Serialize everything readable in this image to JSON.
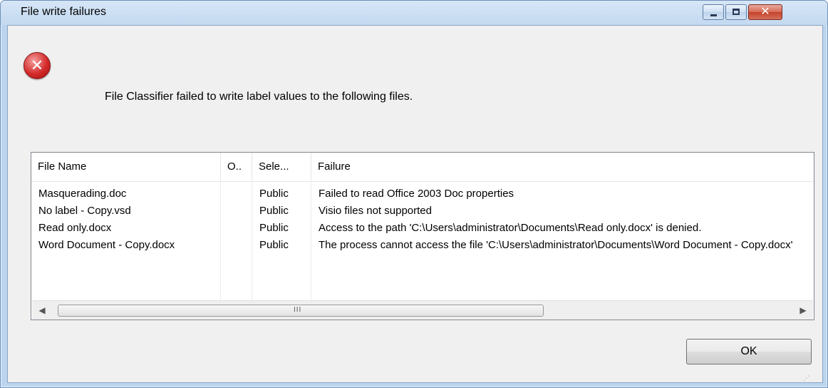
{
  "window": {
    "title": "File write failures",
    "close_glyph": "✕",
    "grip_glyph": "⋰"
  },
  "message": {
    "text": "File Classifier failed to write label values to the following files.",
    "icon_glyph": "✕"
  },
  "table": {
    "columns": [
      "File Name",
      "O..",
      "Sele...",
      "Failure"
    ],
    "rows": [
      [
        "Masquerading.doc",
        "",
        "Public",
        "Failed to read Office 2003 Doc properties"
      ],
      [
        "No label - Copy.vsd",
        "",
        "Public",
        "Visio files not supported"
      ],
      [
        "Read only.docx",
        "",
        "Public",
        "Access to the path 'C:\\Users\\administrator\\Documents\\Read only.docx' is denied."
      ],
      [
        "Word Document - Copy.docx",
        "",
        "Public",
        "The process cannot access the file 'C:\\Users\\administrator\\Documents\\Word Document - Copy.docx'"
      ]
    ]
  },
  "scrollbar": {
    "left_arrow": "◀",
    "right_arrow": "▶",
    "grip": "III"
  },
  "buttons": {
    "ok": "OK"
  },
  "icons": {
    "error": "error-icon",
    "minimize": "minimize-icon",
    "maximize": "maximize-icon",
    "close": "close-icon"
  },
  "colors": {
    "titlebar": "#c3d9f0",
    "error_red": "#d42a2a",
    "client_bg": "#f0f0f0"
  }
}
